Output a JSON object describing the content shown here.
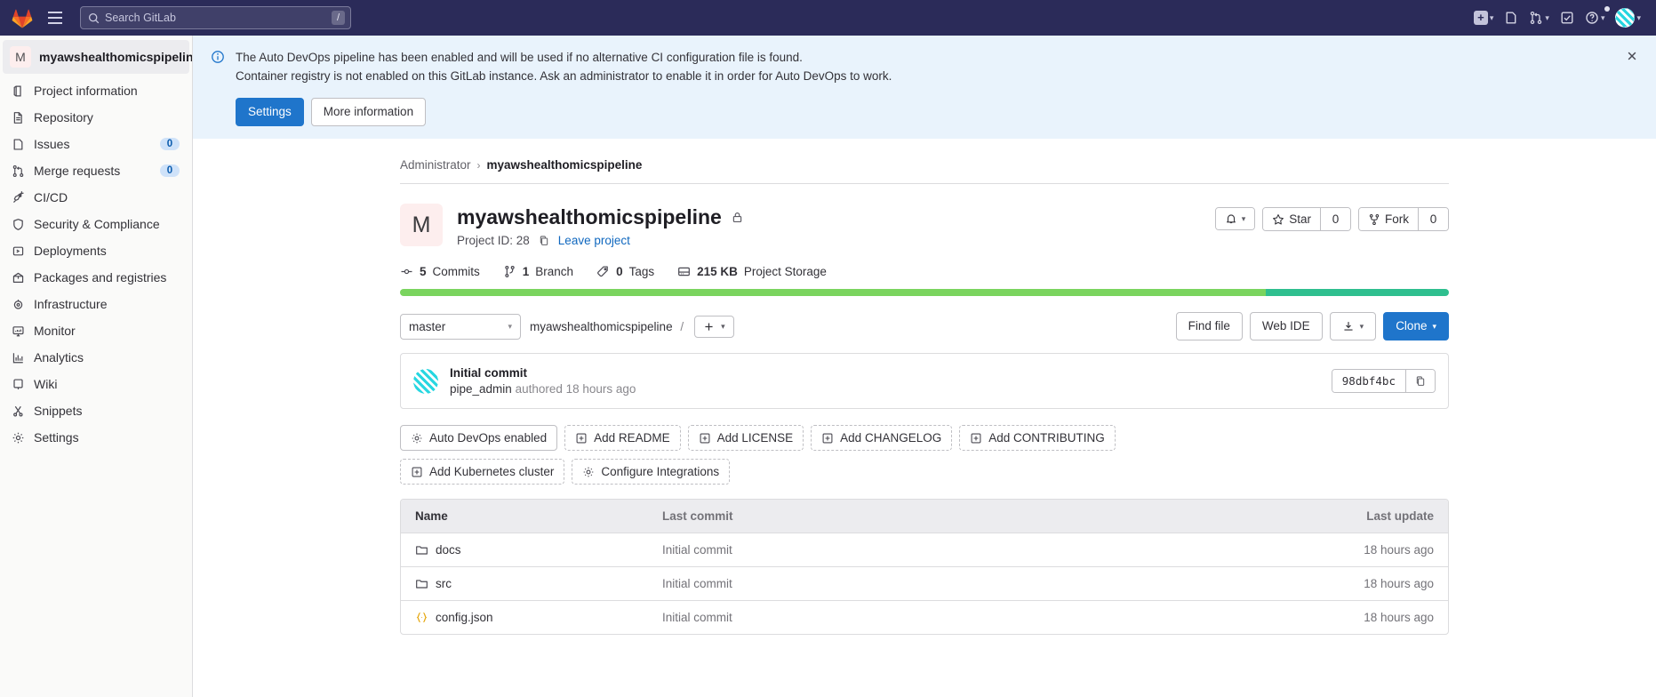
{
  "topnav": {
    "logo_icon": "gitlab-logo-icon",
    "hamburger_icon": "hamburger-menu-icon",
    "search": {
      "placeholder": "Search GitLab",
      "value": "",
      "shortcut": "/"
    },
    "right_items": [
      {
        "name": "create-new-menu",
        "icon": "plus-square-icon",
        "has_caret": true
      },
      {
        "name": "issues-link",
        "icon": "issues-icon",
        "has_caret": false
      },
      {
        "name": "merge-requests-menu",
        "icon": "merge-request-icon",
        "has_caret": true
      },
      {
        "name": "todos-link",
        "icon": "todo-checkbox-icon",
        "has_caret": false
      },
      {
        "name": "help-menu",
        "icon": "question-circle-icon",
        "has_caret": true
      },
      {
        "name": "user-menu",
        "icon": "user-avatar-icon",
        "has_caret": true
      }
    ]
  },
  "sidebar": {
    "project": {
      "initial": "M",
      "name": "myawshealthomicspipeline"
    },
    "items": [
      {
        "label": "Project information",
        "icon": "project-info-icon",
        "badge": null
      },
      {
        "label": "Repository",
        "icon": "repository-doc-icon",
        "badge": null
      },
      {
        "label": "Issues",
        "icon": "issues-icon",
        "badge": "0"
      },
      {
        "label": "Merge requests",
        "icon": "merge-request-icon",
        "badge": "0"
      },
      {
        "label": "CI/CD",
        "icon": "rocket-icon",
        "badge": null
      },
      {
        "label": "Security & Compliance",
        "icon": "shield-icon",
        "badge": null
      },
      {
        "label": "Deployments",
        "icon": "deployments-icon",
        "badge": null
      },
      {
        "label": "Packages and registries",
        "icon": "package-icon",
        "badge": null
      },
      {
        "label": "Infrastructure",
        "icon": "infrastructure-icon",
        "badge": null
      },
      {
        "label": "Monitor",
        "icon": "monitor-icon",
        "badge": null
      },
      {
        "label": "Analytics",
        "icon": "analytics-chart-icon",
        "badge": null
      },
      {
        "label": "Wiki",
        "icon": "wiki-book-icon",
        "badge": null
      },
      {
        "label": "Snippets",
        "icon": "snippets-scissors-icon",
        "badge": null
      },
      {
        "label": "Settings",
        "icon": "gear-icon",
        "badge": null
      }
    ]
  },
  "alert": {
    "icon": "info-circle-icon",
    "line1": "The Auto DevOps pipeline has been enabled and will be used if no alternative CI configuration file is found.",
    "line2": "Container registry is not enabled on this GitLab instance. Ask an administrator to enable it in order for Auto DevOps to work.",
    "primary_button": "Settings",
    "secondary_button": "More information",
    "close_icon": "close-x-icon"
  },
  "breadcrumb": {
    "owner": "Administrator",
    "separator": "›",
    "current": "myawshealthomicspipeline"
  },
  "project": {
    "avatar_initial": "M",
    "title": "myawshealthomicspipeline",
    "visibility_icon": "lock-icon",
    "project_id_label": "Project ID: 28",
    "copy_icon": "copy-clipboard-icon",
    "leave_link": "Leave project",
    "notification_icon": "bell-icon",
    "star": {
      "icon": "star-icon",
      "label": "Star",
      "count": "0"
    },
    "fork": {
      "icon": "fork-icon",
      "label": "Fork",
      "count": "0"
    }
  },
  "stats": [
    {
      "icon": "commit-icon",
      "value": "5",
      "label": "Commits"
    },
    {
      "icon": "branch-icon",
      "value": "1",
      "label": "Branch"
    },
    {
      "icon": "tag-icon",
      "value": "0",
      "label": "Tags"
    },
    {
      "icon": "storage-icon",
      "value": "215 KB",
      "label": "Project Storage"
    }
  ],
  "languages": [
    {
      "name": "primary-language",
      "color": "#7ad45e",
      "percent": 82.5
    },
    {
      "name": "secondary-language",
      "color": "#2fbf8f",
      "percent": 17.5
    }
  ],
  "repo_controls": {
    "ref": "master",
    "ref_caret_icon": "chevron-down-icon",
    "path": "myawshealthomicspipeline",
    "path_separator": "/",
    "add_icon": "plus-icon",
    "add_caret_icon": "chevron-down-icon",
    "find_file": "Find file",
    "web_ide": "Web IDE",
    "download_icon": "download-icon",
    "download_caret_icon": "chevron-down-icon",
    "clone": "Clone",
    "clone_caret_icon": "chevron-down-icon"
  },
  "last_commit": {
    "avatar_icon": "user-avatar-icon",
    "title": "Initial commit",
    "author": "pipe_admin",
    "meta": "authored 18 hours ago",
    "sha": "98dbf4bc",
    "copy_icon": "copy-clipboard-icon"
  },
  "quick_actions": [
    {
      "label": "Auto DevOps enabled",
      "icon": "gear-icon",
      "style": "solid"
    },
    {
      "label": "Add README",
      "icon": "add-square-icon",
      "style": "dashed"
    },
    {
      "label": "Add LICENSE",
      "icon": "add-square-icon",
      "style": "dashed"
    },
    {
      "label": "Add CHANGELOG",
      "icon": "add-square-icon",
      "style": "dashed"
    },
    {
      "label": "Add CONTRIBUTING",
      "icon": "add-square-icon",
      "style": "dashed"
    },
    {
      "label": "Add Kubernetes cluster",
      "icon": "add-square-icon",
      "style": "dashed"
    },
    {
      "label": "Configure Integrations",
      "icon": "gear-icon",
      "style": "dashed"
    }
  ],
  "file_table": {
    "headers": {
      "name": "Name",
      "last_commit": "Last commit",
      "last_update": "Last update"
    },
    "rows": [
      {
        "icon": "folder-icon",
        "name": "docs",
        "last_commit": "Initial commit",
        "last_update": "18 hours ago"
      },
      {
        "icon": "folder-icon",
        "name": "src",
        "last_commit": "Initial commit",
        "last_update": "18 hours ago"
      },
      {
        "icon": "json-file-icon",
        "name": "config.json",
        "last_commit": "Initial commit",
        "last_update": "18 hours ago"
      }
    ]
  }
}
